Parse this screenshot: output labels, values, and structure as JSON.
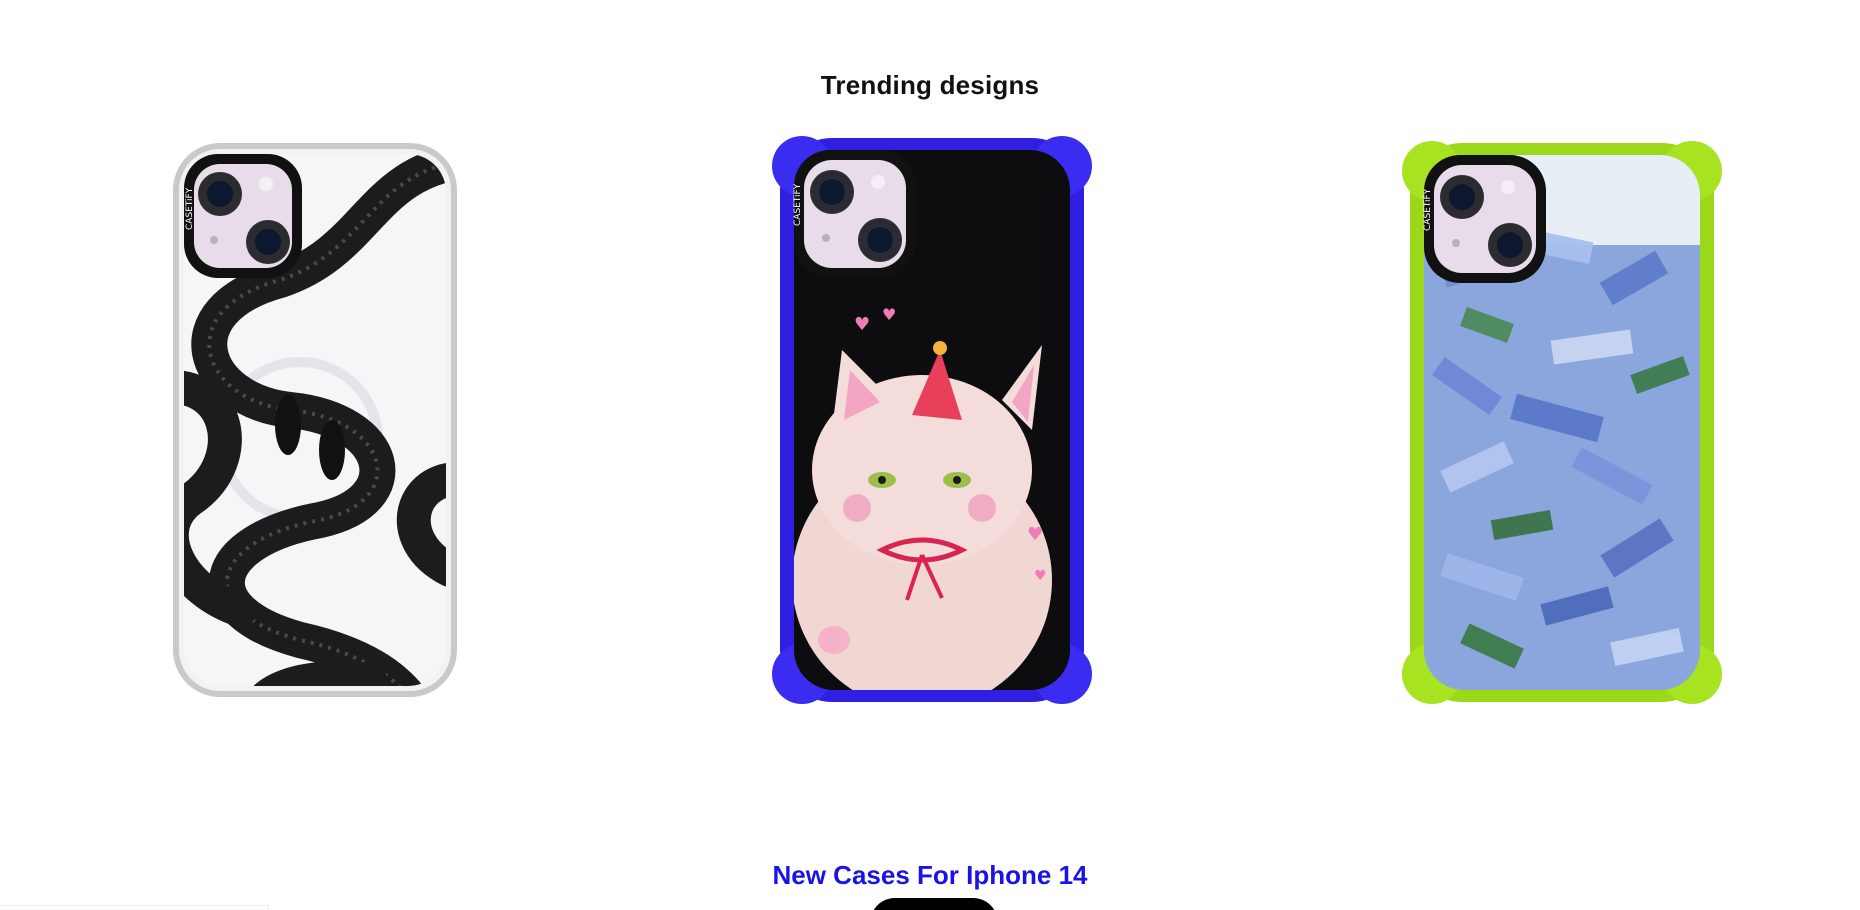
{
  "trending": {
    "title": "Trending designs",
    "products": [
      {
        "design": "black snake on clear case",
        "case_color": "#d9d9dc",
        "brand_mark": "CASETiFY"
      },
      {
        "design": "party cat on black bounce case",
        "case_color": "#2f1fe0",
        "brand_mark": "CASETiFY"
      },
      {
        "design": "blue painted flowers on lime bounce case",
        "case_color": "#9bd81a",
        "brand_mark": "CASETiFY"
      }
    ]
  },
  "new_cases": {
    "title": "New Cases For Iphone 14",
    "button_label": ""
  },
  "colors": {
    "title_text": "#111111",
    "accent_blue": "#1a13e6",
    "button_bg": "#000000"
  }
}
